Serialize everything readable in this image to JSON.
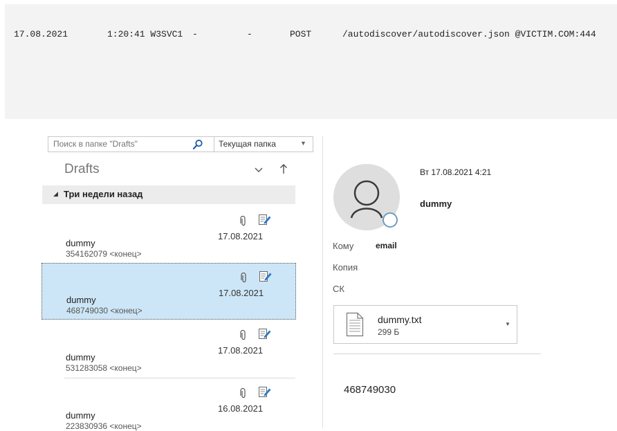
{
  "log": {
    "date": "17.08.2021",
    "time_site": "1:20:41 W3SVC1",
    "dash1": "-",
    "dash2": "-",
    "method": "POST",
    "path": "/autodiscover/autodiscover.json @VICTIM.COM:444"
  },
  "search": {
    "placeholder": "Поиск в папке \"Drafts\"",
    "scope": "Текущая папка"
  },
  "folder": {
    "title": "Drafts"
  },
  "group": {
    "label": "Три недели назад"
  },
  "messages": [
    {
      "sender": "dummy",
      "preview": "354162079 <конец>",
      "date": "17.08.2021"
    },
    {
      "sender": "dummy",
      "preview": "468749030 <конец>",
      "date": "17.08.2021",
      "selected": true
    },
    {
      "sender": "dummy",
      "preview": "531283058 <конец>",
      "date": "17.08.2021"
    },
    {
      "sender": "dummy",
      "preview": "223830936 <конец>",
      "date": "16.08.2021"
    }
  ],
  "reading": {
    "datetime": "Вт 17.08.2021 4:21",
    "from": "dummy",
    "to_label": "Кому",
    "to_value": "email",
    "cc_label": "Копия",
    "bcc_label": "СК",
    "attachment": {
      "name": "dummy.txt",
      "size": "299 Б"
    },
    "body": "468749030"
  },
  "colors": {
    "selected_bg": "#cde6f7",
    "log_bg": "#f3f3f3",
    "group_bg": "#ececec"
  }
}
